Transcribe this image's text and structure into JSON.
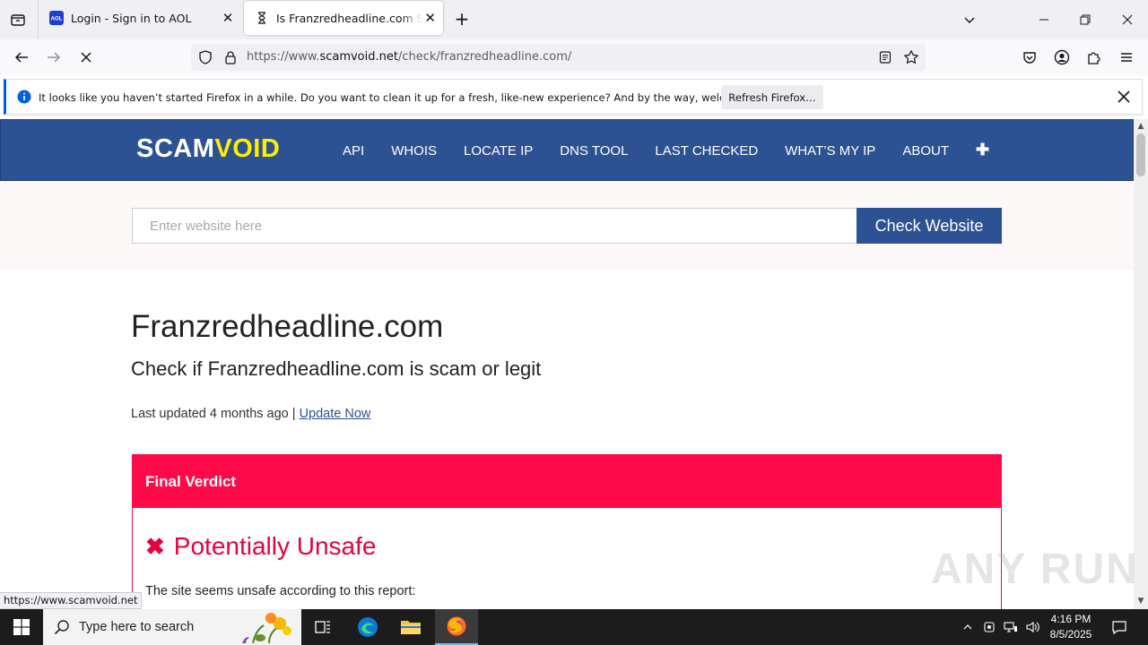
{
  "browser": {
    "tabs": [
      {
        "title": "Login - Sign in to AOL",
        "favicon_text": "AOL"
      },
      {
        "title": "Is Franzredheadline.com Safe ?"
      }
    ],
    "url_prefix": "https://www.",
    "url_domain": "scamvoid.net",
    "url_path": "/check/franzredheadline.com/",
    "notification": {
      "message": "It looks like you haven’t started Firefox in a while. Do you want to clean it up for a fresh, like-new experience? And by the way, welcome back!",
      "button": "Refresh Firefox…"
    },
    "status_url": "https://www.scamvoid.net"
  },
  "site": {
    "logo_part1": "SCAM",
    "logo_part2": "VOID",
    "logo_color_1": "#ffffff",
    "logo_color_2": "#ffee00",
    "header_color": "#2d5294",
    "menu": [
      "API",
      "WHOIS",
      "LOCATE IP",
      "DNS TOOL",
      "LAST CHECKED",
      "WHAT’S MY IP",
      "ABOUT"
    ],
    "menu_more": "✚",
    "search_placeholder": "Enter website here",
    "search_button": "Check Website"
  },
  "report": {
    "domain": "Franzredheadline.com",
    "subtitle": "Check if Franzredheadline.com is scam or legit",
    "last_updated": "Last updated 4 months ago |",
    "update_link": "Update Now",
    "verdict_title": "Final Verdict",
    "verdict_color": "#ff0a48",
    "verdict_icon": "✖",
    "verdict": "Potentially Unsafe",
    "verdict_text": "The site seems unsafe according to this report:"
  },
  "watermark": "ANY RUN",
  "taskbar": {
    "search_placeholder": "Type here to search",
    "time": "4:16 PM",
    "date": "8/5/2025"
  }
}
